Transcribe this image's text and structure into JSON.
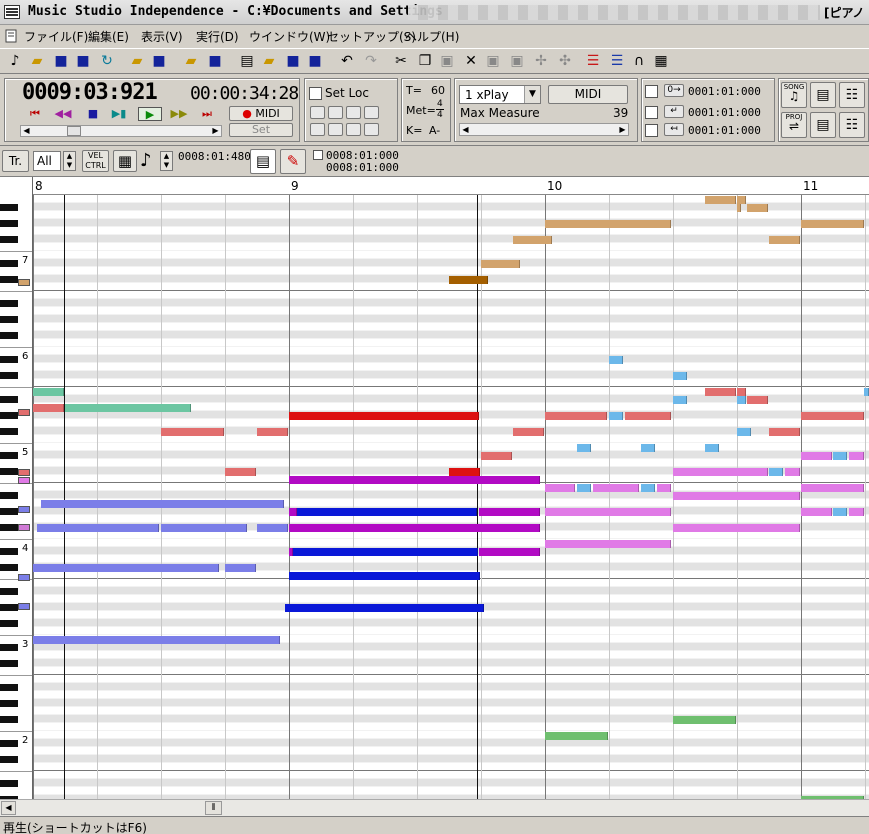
{
  "window": {
    "title": "Music Studio Independence - C:¥Documents and Settings",
    "title_right": "[ピアノ"
  },
  "menu": [
    "ファイル(F)",
    "編集(E)",
    "表示(V)",
    "実行(D)",
    "ウインドウ(W)",
    "セットアップ(S)",
    "ヘルプ(H)"
  ],
  "transport": {
    "position": "0009:03:921",
    "clock": "00:00:34:28",
    "midi_record_label": "MIDI",
    "set_label": "Set",
    "set_loc_label": "Set Loc",
    "tempo_label": "T=",
    "tempo": "60",
    "meter_label": "Met=",
    "meter_num": "4",
    "meter_den": "4",
    "key_label": "K=",
    "key": "A-",
    "play_mode": "1 xPlay",
    "midi_button": "MIDI",
    "max_measure_label": "Max Measure",
    "max_measure": "39",
    "locators": [
      "0001:01:000",
      "0001:01:000",
      "0001:01:000"
    ],
    "song_label": "SONG",
    "proj_label": "PROJ"
  },
  "edit_bar": {
    "track_label": "Tr.",
    "filter_value": "All",
    "vel_label": "VEL",
    "ctrl_label": "CTRL",
    "grid_value": "0008:01:480",
    "range_start": "0008:01:000",
    "range_end": "0008:01:000"
  },
  "roll": {
    "measures": [
      "8",
      "9",
      "10",
      "11"
    ],
    "octave_labels": [
      "7",
      "6",
      "5",
      "4",
      "3",
      "2"
    ]
  },
  "status": {
    "text": "再生(ショートカットはF6)"
  },
  "colors": {
    "red": "#dd1111",
    "blue": "#0a18d8",
    "magenta": "#b20ac4",
    "tan": "#d2a36c",
    "dark_orange": "#a45f00",
    "salmon": "#e26e6e",
    "periwinkle": "#7b7ee8",
    "teal": "#6cc6a2",
    "sky": "#6cb8ea",
    "pink": "#e07ae6",
    "green": "#6fbf6f"
  }
}
